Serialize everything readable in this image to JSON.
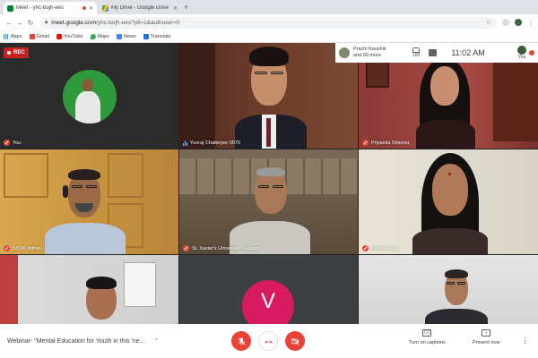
{
  "tabs": [
    {
      "label": "Meet - yhc-bojh-ees",
      "favicon": "meet-icon",
      "active": true,
      "recording": true
    },
    {
      "label": "My Drive - Google Drive",
      "favicon": "drive-icon",
      "active": false
    }
  ],
  "url": {
    "host": "meet.google.com",
    "path": "/yhc-bojh-ees?pli=1&authuser=0"
  },
  "bookmarks": [
    {
      "label": "Apps",
      "icon": "apps-icon"
    },
    {
      "label": "Gmail",
      "icon": "gmail-icon"
    },
    {
      "label": "YouTube",
      "icon": "youtube-icon"
    },
    {
      "label": "Maps",
      "icon": "maps-icon"
    },
    {
      "label": "News",
      "icon": "news-icon"
    },
    {
      "label": "Translate",
      "icon": "translate-icon"
    }
  ],
  "recording_badge": "REC",
  "topbar": {
    "presenter_line1": "Prachi Kaushik",
    "presenter_line2": "and 90 more",
    "participant_count": "100",
    "time": "11:02 AM",
    "self_label": "You"
  },
  "tiles": [
    {
      "name": "You",
      "indicator": "mic-off"
    },
    {
      "name": "Yuvraj Chatterjee 0070",
      "indicator": "speaking"
    },
    {
      "name": "Priyanka Sharma",
      "indicator": "mic-off"
    },
    {
      "name": "SXUK Admin",
      "indicator": "mic-off"
    },
    {
      "name": "St. Xavier's University, Kolkata",
      "indicator": "mic-off"
    },
    {
      "name": "Krishna Roy",
      "indicator": "mic-off"
    },
    {
      "name": "",
      "indicator": "none"
    },
    {
      "name": "",
      "initial": "V",
      "indicator": "none"
    },
    {
      "name": "",
      "indicator": "none"
    }
  ],
  "bottombar": {
    "meeting_title": "Webinar- \"Mental Education for Youth in this 'ne...",
    "captions_label": "Turn on captions",
    "present_label": "Present now"
  },
  "colors": {
    "mic_off_red": "#ea4335",
    "rec_red": "#c5221f",
    "avatar_pink": "#d81b60",
    "meet_bg": "#202124"
  }
}
